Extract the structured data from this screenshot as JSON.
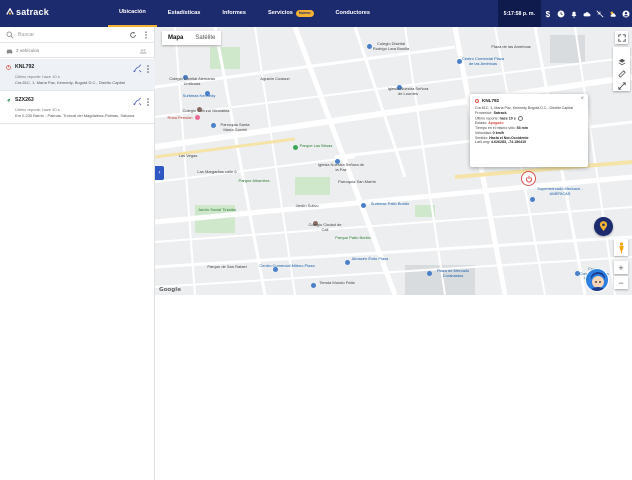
{
  "app": {
    "brand": "satrack",
    "nav": [
      {
        "label": "Ubicación",
        "active": true
      },
      {
        "label": "Estadísticas",
        "active": false
      },
      {
        "label": "Informes",
        "active": false
      },
      {
        "label": "Servicios",
        "active": false,
        "badge": "Nuevo"
      },
      {
        "label": "Conductores",
        "active": false
      }
    ],
    "time": "5:17:58 p. m.",
    "tools": [
      "dollar-icon",
      "clock-icon",
      "bell-icon",
      "cloud-icon",
      "collapse-icon",
      "weather-icon",
      "user-icon"
    ]
  },
  "sidebar": {
    "search_placeholder": "Buscar",
    "vehicle_count": "2 vehículos",
    "vehicles": [
      {
        "plate": "KNL792",
        "report": "Último reporte: hace 10 s",
        "address": "Cra 81C, 1, María Paz, Kennedy, Bogotá D.C., Distrito Capital",
        "status": "off",
        "selected": true
      },
      {
        "plate": "SZX263",
        "report": "Último reporte: hace 40 s",
        "address": "Km 0.230 Barrio - Palmas. Troncal del Magdalena-Palmas, Sabana",
        "status": "moving",
        "selected": false
      }
    ]
  },
  "map": {
    "tabs": [
      "Mapa",
      "Satélite"
    ],
    "active_tab": "Mapa",
    "collapse_label": "‹",
    "google": "Google",
    "labels": [
      {
        "text": "Colegio Distrital Rodrigo Lara Bonilla",
        "cls": ""
      },
      {
        "text": "Centro Comercial Plaza de las Américas",
        "cls": "blue"
      },
      {
        "text": "Colegio Distrital Alemania Unificada",
        "cls": ""
      },
      {
        "text": "Agustín Codazzi",
        "cls": ""
      },
      {
        "text": "Iglesia Nuestra Señora de Lourdes",
        "cls": ""
      },
      {
        "text": "Surtimax Kennedy",
        "cls": "blue"
      },
      {
        "text": "Plaza de las Américas",
        "cls": ""
      },
      {
        "text": "Colegio Cultural Nicolaitas",
        "cls": ""
      },
      {
        "text": "Rosa Pensión",
        "cls": "red"
      },
      {
        "text": "Parroquia Santa María Goretti",
        "cls": ""
      },
      {
        "text": "Parque Las Brisas",
        "cls": "green"
      },
      {
        "text": "Las Vegas",
        "cls": ""
      },
      {
        "text": "Las Margaritas calle 6",
        "cls": ""
      },
      {
        "text": "Parque Alhambra",
        "cls": "green"
      },
      {
        "text": "Iglesia Nuestra Señora de la Paz",
        "cls": ""
      },
      {
        "text": "Parroquia San Martín",
        "cls": ""
      },
      {
        "text": "Surtimax Patio Bonito",
        "cls": "blue"
      },
      {
        "text": "Jardín Social Tintalito",
        "cls": "green"
      },
      {
        "text": "Jardín Solivo",
        "cls": ""
      },
      {
        "text": "Colegio Ciudad de Cali",
        "cls": ""
      },
      {
        "text": "Parque de San Rafael",
        "cls": ""
      },
      {
        "text": "Parque Patio Bonito",
        "cls": "green"
      },
      {
        "text": "Supermercado Merkaorí - AMÉRICAS",
        "cls": "blue"
      },
      {
        "text": "Centro Comercial Mileno Plaza",
        "cls": "blue"
      },
      {
        "text": "Almacén Éxito Plaza",
        "cls": "blue"
      },
      {
        "text": "Plaza de Mercado Corabastos",
        "cls": "blue"
      },
      {
        "text": "Tienda Mundo Patio",
        "cls": ""
      },
      {
        "text": "Centro Comercial Plaza de Abastos",
        "cls": "blue"
      }
    ],
    "popup": {
      "plate": "KNL792",
      "address": "Cra 81C, 1, María Paz, Kennedy Bogotá D.C., Distrito Capital",
      "provider_label": "Proveedor:",
      "provider": "Satrack",
      "report_label": "Último reporte:",
      "report": "hace 10 s",
      "state_label": "Estado:",
      "state": "Apagado",
      "time_label": "Tiempo en el mismo sitio:",
      "time": "53 min",
      "speed_label": "Velocidad:",
      "speed": "0 km/h",
      "direction_label": "Sentido:",
      "direction": "Hacia el Nor-Occidente",
      "latlong_label": "Lat/Long:",
      "latlong": "4.626283, -74.156410"
    }
  },
  "colors": {
    "topbar": "#1c2a6e",
    "accent": "#f2b233",
    "status_off": "#d9534f",
    "status_moving": "#2d8f5c"
  }
}
